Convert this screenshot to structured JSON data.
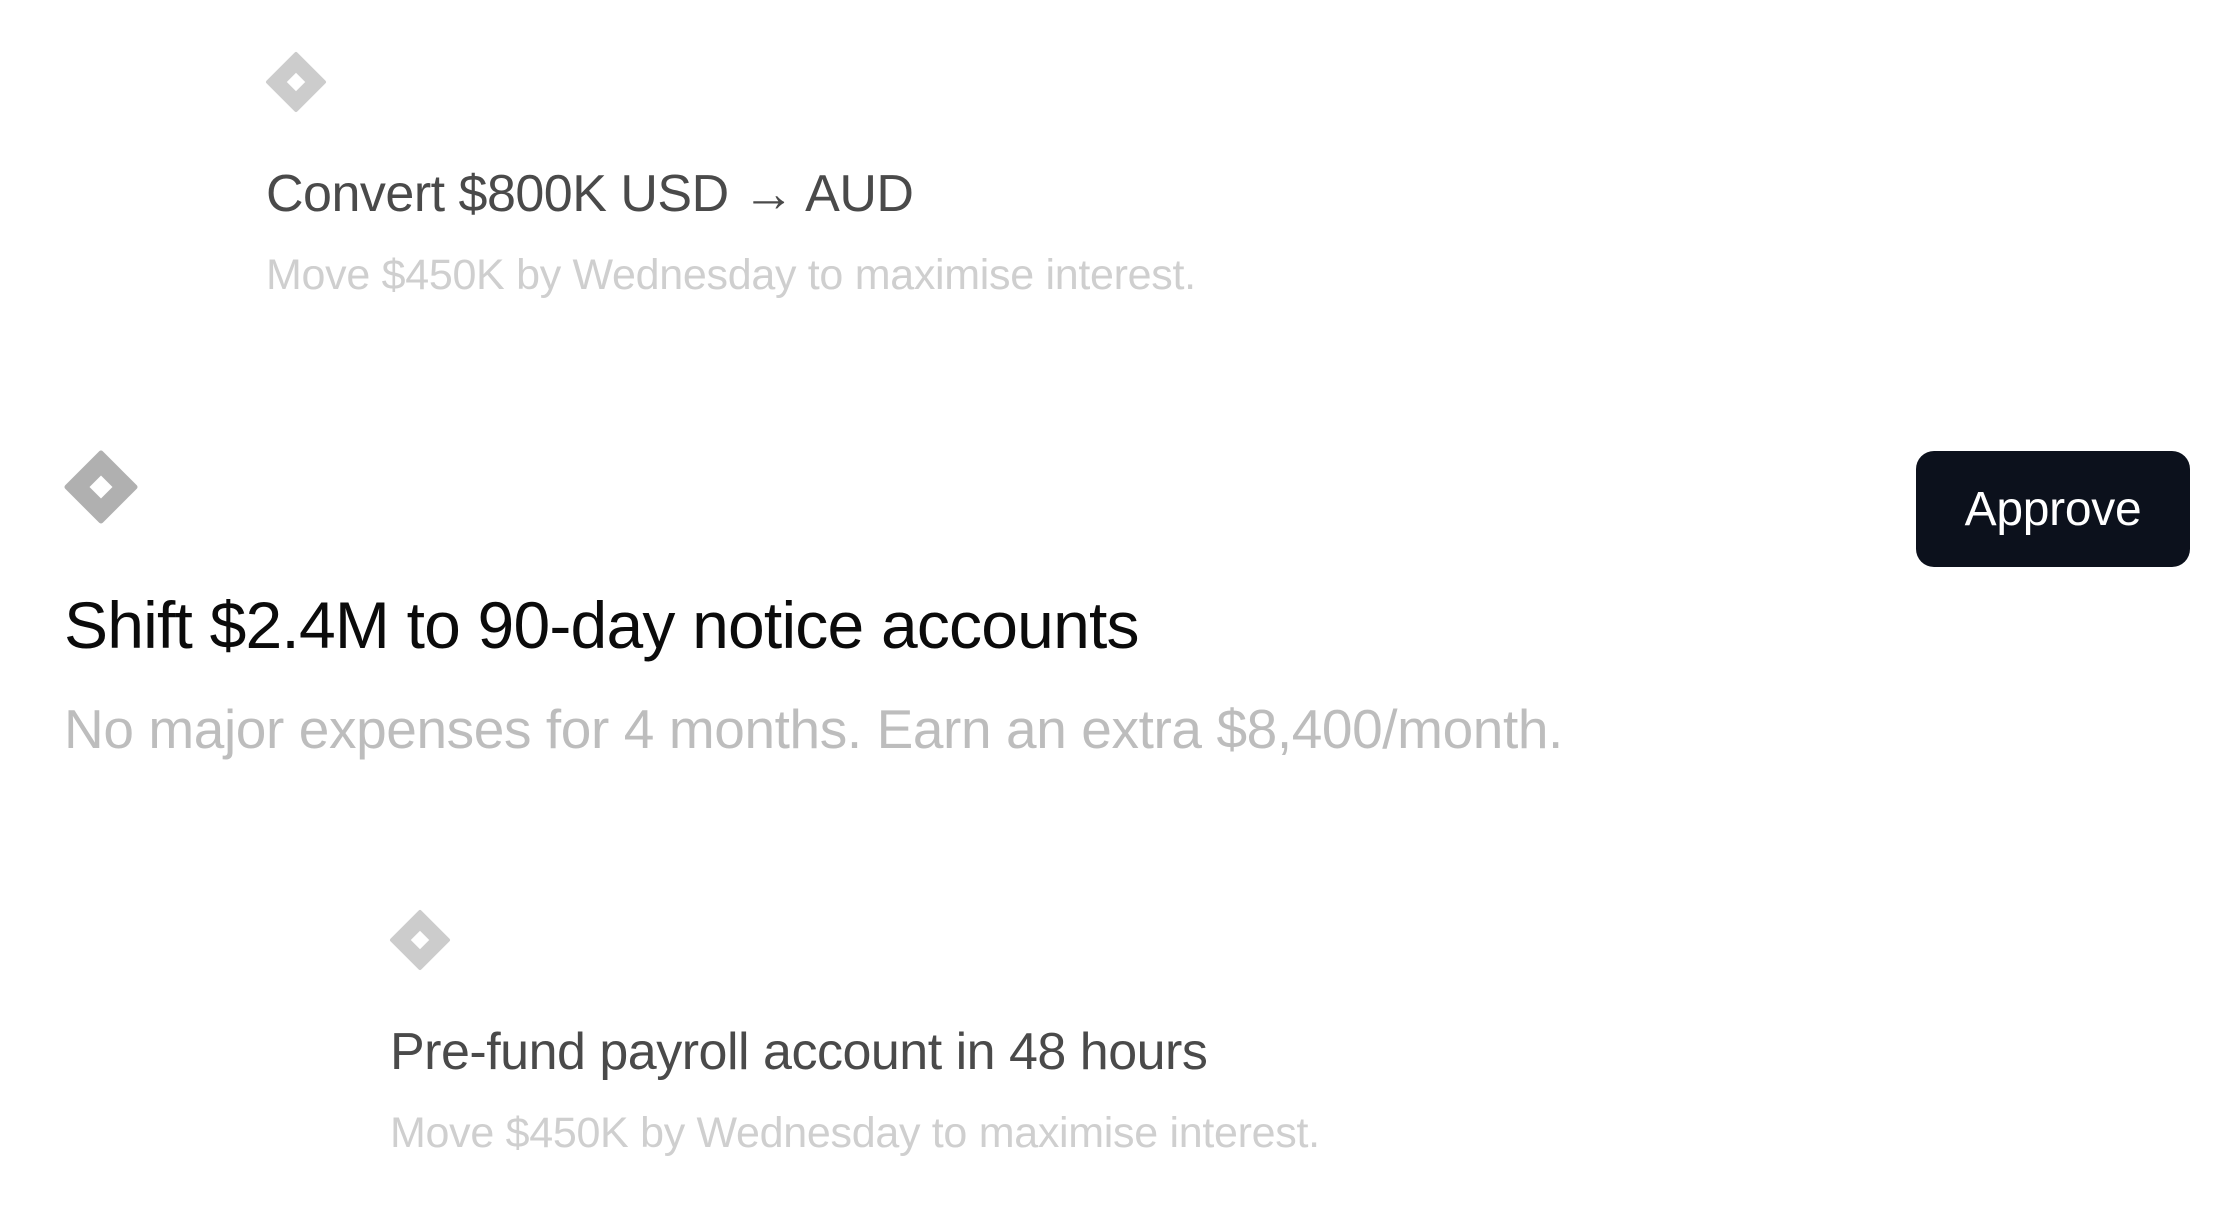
{
  "colors": {
    "background": "#ffffff",
    "button_bg": "#0c111c",
    "button_text": "#ffffff",
    "focused_title": "#0b0b0b",
    "faded_title": "#4a4a4a",
    "subtitle_faded": "#cfcfcf",
    "subtitle_focused": "#bdbdbd",
    "diamond_focused": "#b0b0b0",
    "diamond_faded": "#cccccc"
  },
  "cards": [
    {
      "icon": "diamond-ring-icon",
      "title": "Convert $800K USD → AUD",
      "subtitle": "Move $450K by Wednesday to maximise interest.",
      "state": "faded"
    },
    {
      "icon": "diamond-ring-icon",
      "title": "Shift $2.4M to 90-day notice accounts",
      "subtitle": "No major expenses for 4 months. Earn an extra $8,400/month.",
      "state": "focused",
      "action_label": "Approve"
    },
    {
      "icon": "diamond-ring-icon",
      "title": "Pre-fund payroll account in 48 hours",
      "subtitle": "Move $450K by Wednesday to maximise interest.",
      "state": "faded"
    }
  ]
}
